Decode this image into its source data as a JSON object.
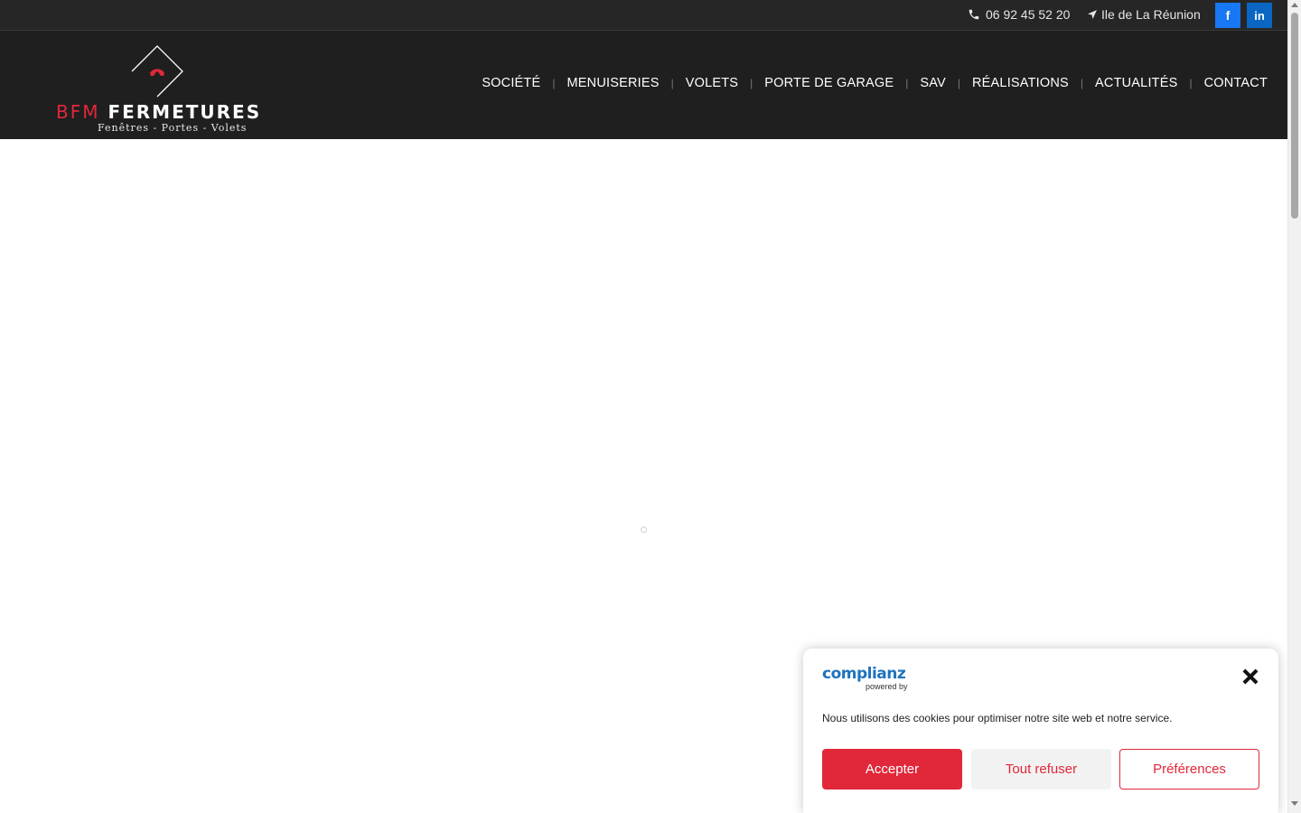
{
  "topbar": {
    "phone": "06 92 45 52 20",
    "location": "Ile de La Réunion",
    "social": [
      {
        "icon": "facebook-icon",
        "label": "f",
        "color": "#1877f2"
      },
      {
        "icon": "linkedin-icon",
        "label": "in",
        "color": "#0a66c2"
      }
    ]
  },
  "logo": {
    "brand_red": "BFM",
    "brand_white": "FERMETURES",
    "tagline": "Fenêtres - Portes - Volets"
  },
  "nav": {
    "items": [
      "SOCIÉTÉ",
      "MENUISERIES",
      "VOLETS",
      "PORTE DE GARAGE",
      "SAV",
      "RÉALISATIONS",
      "ACTUALITÉS",
      "CONTACT"
    ],
    "separator": "|"
  },
  "cookie": {
    "logo_text": "complianz",
    "powered_by": "powered by",
    "message": "Nous utilisons des cookies pour optimiser notre site web et notre service.",
    "accept": "Accepter",
    "deny": "Tout refuser",
    "preferences": "Préférences"
  },
  "colors": {
    "accent": "#e0283a",
    "header_bg": "#1f1f1f",
    "topbar_bg": "#262626",
    "complianz_blue": "#1e73be"
  }
}
